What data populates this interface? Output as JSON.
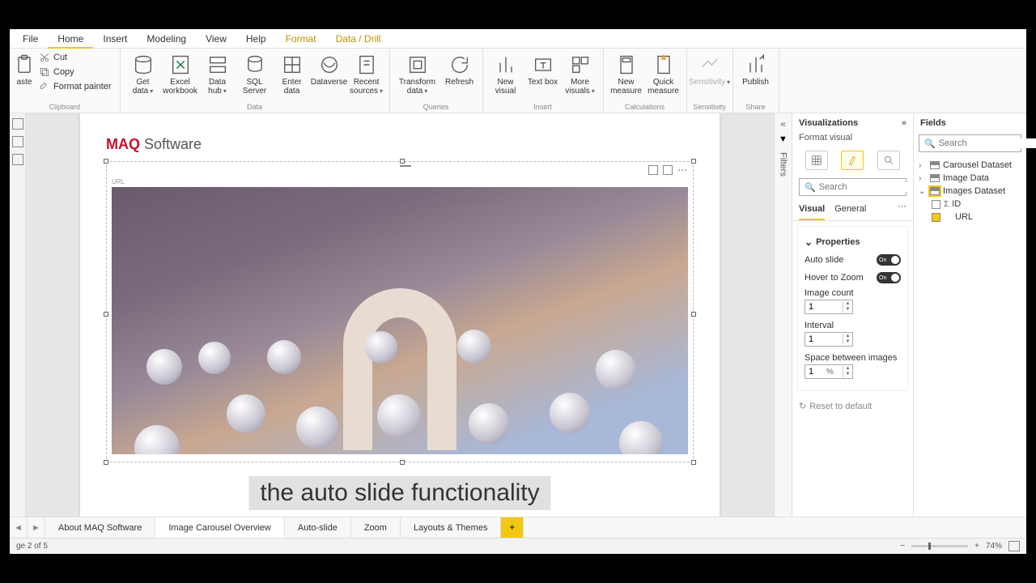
{
  "menu": {
    "file": "File",
    "home": "Home",
    "insert": "Insert",
    "modeling": "Modeling",
    "view": "View",
    "help": "Help",
    "format": "Format",
    "datadrill": "Data / Drill"
  },
  "ribbon": {
    "clipboard": {
      "label": "Clipboard",
      "paste": "aste",
      "cut": "Cut",
      "copy": "Copy",
      "format_painter": "Format painter"
    },
    "data": {
      "label": "Data",
      "get_data": "Get data",
      "excel": "Excel workbook",
      "datahub": "Data hub",
      "sql": "SQL Server",
      "enter": "Enter data",
      "dataverse": "Dataverse",
      "recent": "Recent sources"
    },
    "queries": {
      "label": "Queries",
      "transform": "Transform data",
      "refresh": "Refresh"
    },
    "insert": {
      "label": "Insert",
      "new_visual": "New visual",
      "text_box": "Text box",
      "more": "More visuals"
    },
    "calc": {
      "label": "Calculations",
      "new_measure": "New measure",
      "quick_measure": "Quick measure"
    },
    "sens": {
      "label": "Sensitivity",
      "btn": "Sensitivity"
    },
    "share": {
      "label": "Share",
      "publish": "Publish"
    }
  },
  "logo": {
    "brand": "MAQ",
    "suffix": " Software"
  },
  "visual": {
    "url_label": "URL"
  },
  "caption": "the auto slide functionality",
  "filters_label": "Filters",
  "viz": {
    "title": "Visualizations",
    "subtitle": "Format visual",
    "search_placeholder": "Search",
    "tab_visual": "Visual",
    "tab_general": "General",
    "section": "Properties",
    "auto_slide": "Auto slide",
    "hover_zoom": "Hover to Zoom",
    "toggle_on": "On",
    "image_count": {
      "label": "Image count",
      "value": "1"
    },
    "interval": {
      "label": "Interval",
      "value": "1"
    },
    "space": {
      "label": "Space between images",
      "value": "1",
      "unit": "%"
    },
    "reset": "Reset to default"
  },
  "fields": {
    "title": "Fields",
    "search_placeholder": "Search",
    "tables": {
      "carousel": "Carousel Dataset",
      "image_data": "Image Data",
      "images_dataset": "Images Dataset",
      "id": "ID",
      "url": "URL"
    }
  },
  "sheets": {
    "about": "About MAQ Software",
    "overview": "Image Carousel Overview",
    "auto": "Auto-slide",
    "zoom": "Zoom",
    "layouts": "Layouts & Themes",
    "add": "+"
  },
  "status": {
    "page": "ge 2 of 5",
    "zoom": "74%"
  }
}
